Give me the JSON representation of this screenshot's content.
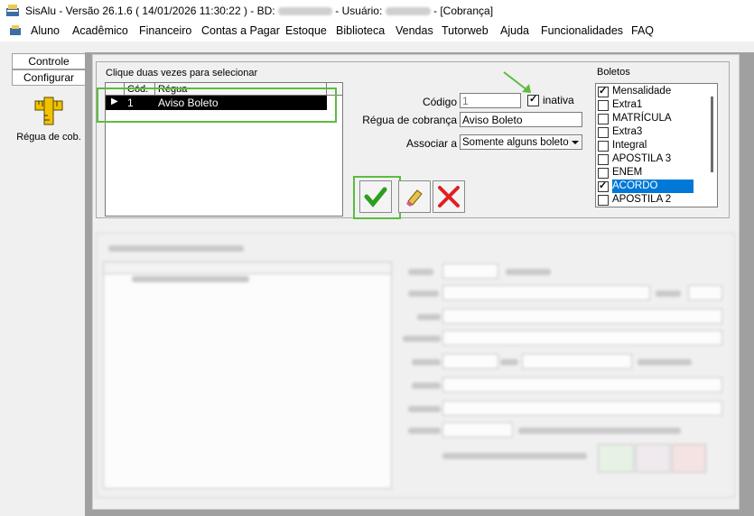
{
  "window": {
    "title_prefix": "SisAlu - Versão 26.1.6 ( 14/01/2026 11:30:22 ) - BD:",
    "title_user": "- Usuário:",
    "title_suffix": "- [Cobrança]"
  },
  "menu": [
    "Aluno",
    "Acadêmico",
    "Financeiro",
    "Contas a Pagar",
    "Estoque",
    "Biblioteca",
    "Vendas",
    "Tutorweb",
    "Ajuda",
    "Funcionalidades",
    "FAQ"
  ],
  "left_panel": {
    "tab_controle": "Controle",
    "tab_configurar": "Configurar",
    "tool_label": "Régua de cob."
  },
  "selection": {
    "caption": "Clique duas vezes para selecionar",
    "columns": [
      "Cód.",
      "Régua"
    ],
    "rows": [
      {
        "cod": "1",
        "regua": "Aviso Boleto"
      }
    ]
  },
  "form": {
    "codigo_label": "Código",
    "codigo_value": "1",
    "inativa_label": "inativa",
    "inativa_checked": true,
    "regua_label": "Régua de cobrança",
    "regua_value": "Aviso Boleto",
    "associar_label": "Associar a",
    "associar_value": "Somente alguns boletos"
  },
  "boletos": {
    "title": "Boletos",
    "items": [
      {
        "label": "Mensalidade",
        "checked": true,
        "selected": false
      },
      {
        "label": "Extra1",
        "checked": false,
        "selected": false
      },
      {
        "label": "MATRÍCULA",
        "checked": false,
        "selected": false
      },
      {
        "label": "Extra3",
        "checked": false,
        "selected": false
      },
      {
        "label": "Integral",
        "checked": false,
        "selected": false
      },
      {
        "label": "APOSTILA 3",
        "checked": false,
        "selected": false
      },
      {
        "label": "ENEM",
        "checked": false,
        "selected": false
      },
      {
        "label": "ACORDO",
        "checked": true,
        "selected": true
      },
      {
        "label": "APOSTILA 2",
        "checked": false,
        "selected": false
      }
    ]
  },
  "colors": {
    "accent_green": "#5dbb3f",
    "confirm_green": "#2e9e1f",
    "cancel_red": "#e02020",
    "selection_blue": "#0078d7",
    "gray_area": "#a0a0a0"
  },
  "icons": [
    "app-icon",
    "menu-icon",
    "ruler-icon",
    "green-arrow-icon",
    "confirm-check-icon",
    "eraser-icon",
    "cancel-x-icon"
  ]
}
